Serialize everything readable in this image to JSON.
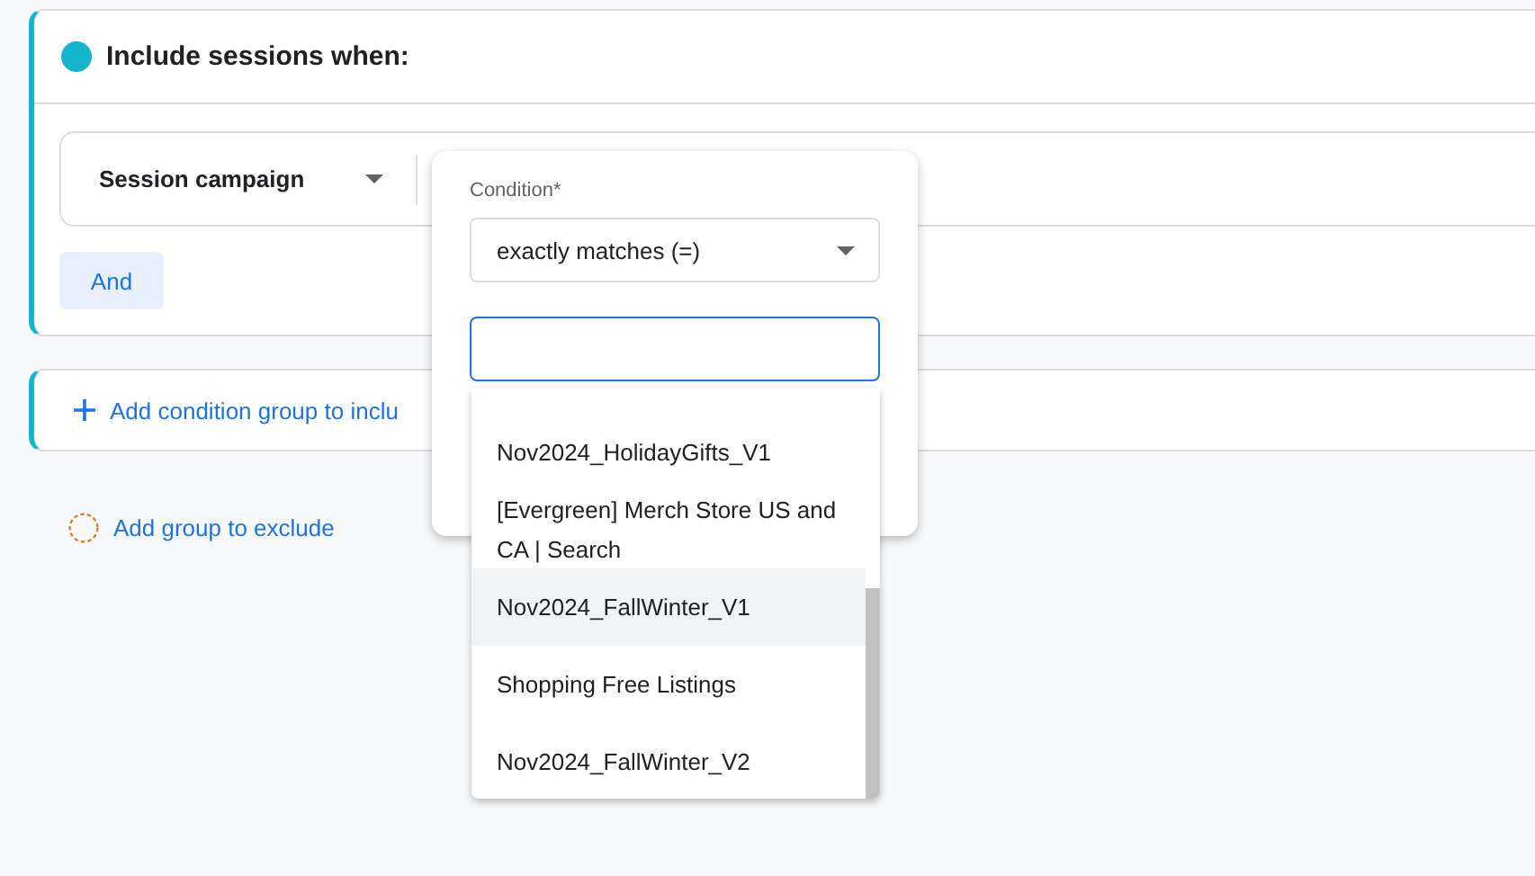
{
  "include_card": {
    "title": "Include sessions when:",
    "condition": {
      "dimension": "Session campaign"
    },
    "and_button": "And"
  },
  "add_include_group": {
    "label": "Add condition group to inclu"
  },
  "add_exclude_group": {
    "label": "Add group to exclude"
  },
  "condition_popover": {
    "label": "Condition*",
    "operator": "exactly matches (=)"
  },
  "suggestions": [
    {
      "label": "Nov2024_HolidayGifts_V1",
      "selected": false
    },
    {
      "label": "[Evergreen] Merch Store US and CA | Search",
      "selected": false
    },
    {
      "label": "Nov2024_FallWinter_V1",
      "selected": true
    },
    {
      "label": "Shopping Free Listings",
      "selected": false
    },
    {
      "label": "Nov2024_FallWinter_V2",
      "selected": false
    }
  ]
}
